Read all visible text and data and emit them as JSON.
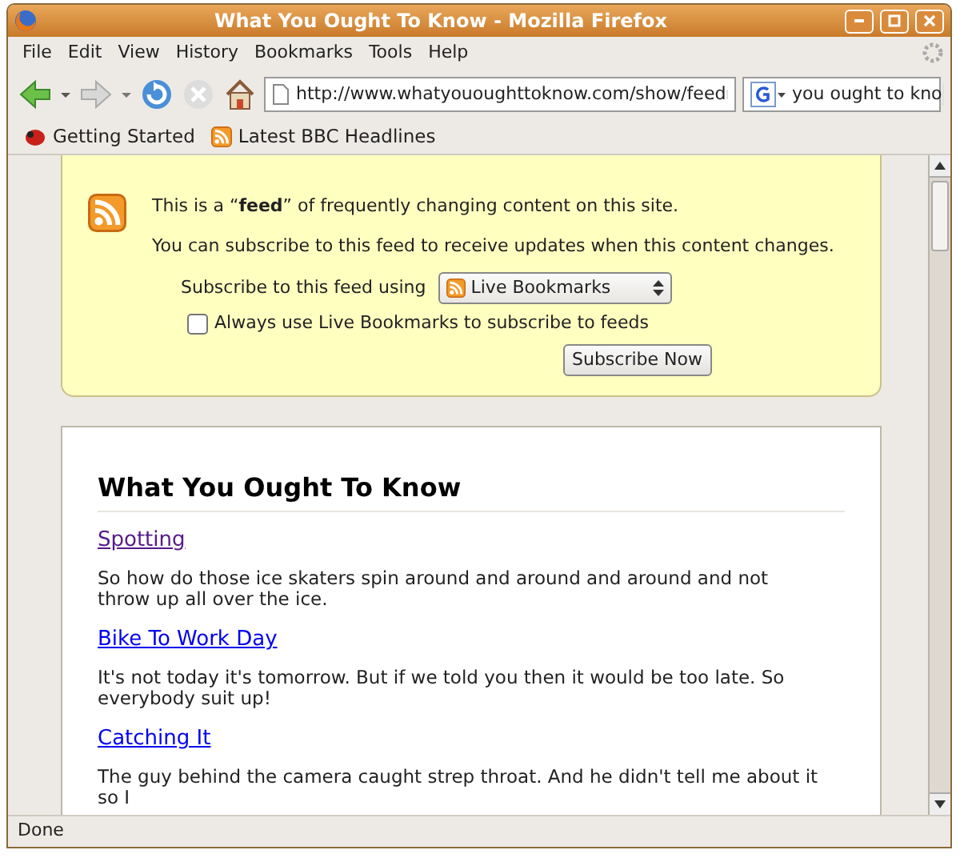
{
  "window": {
    "title": "What You Ought To Know - Mozilla Firefox"
  },
  "menu": [
    "File",
    "Edit",
    "View",
    "History",
    "Bookmarks",
    "Tools",
    "Help"
  ],
  "toolbar": {
    "url": "http://www.whatyououghttoknow.com/show/feed",
    "search": "you ought to kno"
  },
  "bookmarks": [
    {
      "label": "Getting Started",
      "kind": "bug"
    },
    {
      "label": "Latest BBC Headlines",
      "kind": "feed"
    }
  ],
  "feed_box": {
    "intro": "This is a “**feed**” of frequently changing content on this site.",
    "subscribe_info": "You can subscribe to this feed to receive updates when this content changes.",
    "using_label": "Subscribe to this feed using",
    "reader": "Live Bookmarks",
    "always_use": {
      "label": "Always use Live Bookmarks to subscribe to feeds",
      "checked": false
    },
    "button": "Subscribe Now"
  },
  "feed": {
    "title": "What You Ought To Know",
    "entries": [
      {
        "title": "Spotting",
        "visited": true,
        "text": "So how do those ice skaters spin around and around and around and not throw up all over the ice."
      },
      {
        "title": "Bike To Work Day",
        "visited": false,
        "text": "It's not today it's tomorrow. But if we told you then it would be too late. So everybody suit up!"
      },
      {
        "title": "Catching It",
        "visited": false,
        "text": "The guy behind the camera caught strep throat. And he didn't tell me about it so I"
      }
    ]
  },
  "status_bar": "Done"
}
